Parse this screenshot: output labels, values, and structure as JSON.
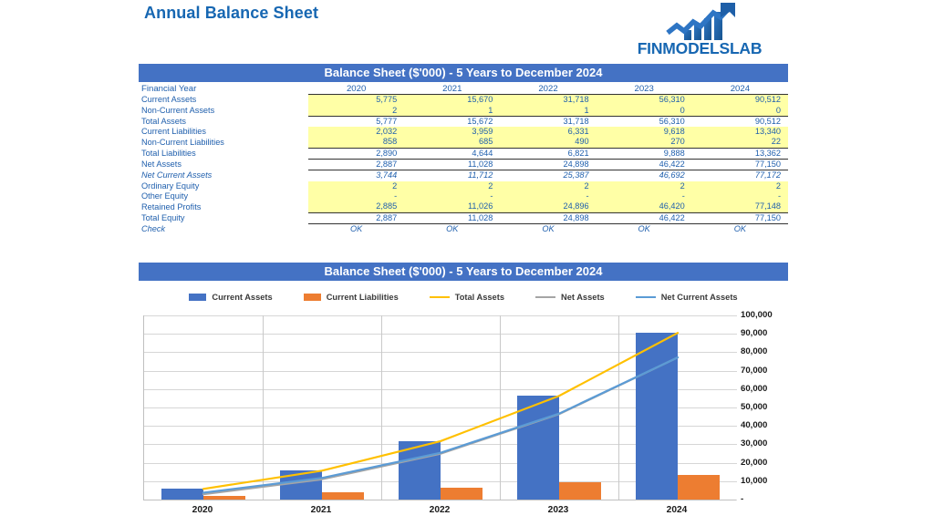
{
  "header": {
    "title": "Annual Balance Sheet",
    "logo_text": "FINMODELSLAB",
    "logo_icon": "bar-chart-arrow-icon",
    "brand_color": "#1767b2"
  },
  "table_band": {
    "title": "Balance Sheet ($'000) - 5 Years to December 2024"
  },
  "chart_band": {
    "title": "Balance Sheet ($'000) - 5 Years to December 2024"
  },
  "table": {
    "row_header_label": "Financial Year",
    "years": [
      "2020",
      "2021",
      "2022",
      "2023",
      "2024"
    ],
    "rows": [
      {
        "label": "Current Assets",
        "values": [
          "5,775",
          "15,670",
          "31,718",
          "56,310",
          "90,512"
        ],
        "style": "input"
      },
      {
        "label": "Non-Current Assets",
        "values": [
          "2",
          "1",
          "1",
          "0",
          "0"
        ],
        "style": "input"
      },
      {
        "label": "Total Assets",
        "values": [
          "5,777",
          "15,672",
          "31,718",
          "56,310",
          "90,512"
        ],
        "style": "total"
      },
      {
        "label": "Current Liabilities",
        "values": [
          "2,032",
          "3,959",
          "6,331",
          "9,618",
          "13,340"
        ],
        "style": "input"
      },
      {
        "label": "Non-Current Liabilities",
        "values": [
          "858",
          "685",
          "490",
          "270",
          "22"
        ],
        "style": "input"
      },
      {
        "label": "Total Liabilities",
        "values": [
          "2,890",
          "4,644",
          "6,821",
          "9,888",
          "13,362"
        ],
        "style": "total"
      },
      {
        "label": "Net Assets",
        "values": [
          "2,887",
          "11,028",
          "24,898",
          "46,422",
          "77,150"
        ],
        "style": "total"
      },
      {
        "label": "Net Current Assets",
        "values": [
          "3,744",
          "11,712",
          "25,387",
          "46,692",
          "77,172"
        ],
        "style": "italic"
      },
      {
        "label": "Ordinary Equity",
        "values": [
          "2",
          "2",
          "2",
          "2",
          "2"
        ],
        "style": "input"
      },
      {
        "label": "Other Equity",
        "values": [
          "-",
          "-",
          "-",
          "-",
          "-"
        ],
        "style": "input"
      },
      {
        "label": "Retained Profits",
        "values": [
          "2,885",
          "11,026",
          "24,896",
          "46,420",
          "77,148"
        ],
        "style": "input"
      },
      {
        "label": "Total Equity",
        "values": [
          "2,887",
          "11,028",
          "24,898",
          "46,422",
          "77,150"
        ],
        "style": "total"
      },
      {
        "label": "Check",
        "values": [
          "OK",
          "OK",
          "OK",
          "OK",
          "OK"
        ],
        "style": "check"
      }
    ]
  },
  "chart_data": {
    "type": "bar",
    "title": "Balance Sheet ($'000) - 5 Years to December 2024",
    "xlabel": "",
    "ylabel": "",
    "categories": [
      "2020",
      "2021",
      "2022",
      "2023",
      "2024"
    ],
    "ylim": [
      0,
      100000
    ],
    "ytick_labels": [
      "-",
      "10,000",
      "20,000",
      "30,000",
      "40,000",
      "50,000",
      "60,000",
      "70,000",
      "80,000",
      "90,000",
      "100,000"
    ],
    "ytick_values": [
      0,
      10000,
      20000,
      30000,
      40000,
      50000,
      60000,
      70000,
      80000,
      90000,
      100000
    ],
    "grid": true,
    "legend_position": "top",
    "series": [
      {
        "name": "Current Assets",
        "kind": "bar",
        "color": "#4472c4",
        "values": [
          5775,
          15670,
          31718,
          56310,
          90512
        ]
      },
      {
        "name": "Current Liabilities",
        "kind": "bar",
        "color": "#ed7d31",
        "values": [
          2032,
          3959,
          6331,
          9618,
          13340
        ]
      },
      {
        "name": "Total Assets",
        "kind": "line",
        "color": "#ffc000",
        "values": [
          5777,
          15672,
          31718,
          56310,
          90512
        ]
      },
      {
        "name": "Net Assets",
        "kind": "line",
        "color": "#a5a5a5",
        "values": [
          2887,
          11028,
          24898,
          46422,
          77150
        ]
      },
      {
        "name": "Net Current Assets",
        "kind": "line",
        "color": "#5b9bd5",
        "values": [
          3744,
          11712,
          25387,
          46692,
          77172
        ]
      }
    ]
  }
}
